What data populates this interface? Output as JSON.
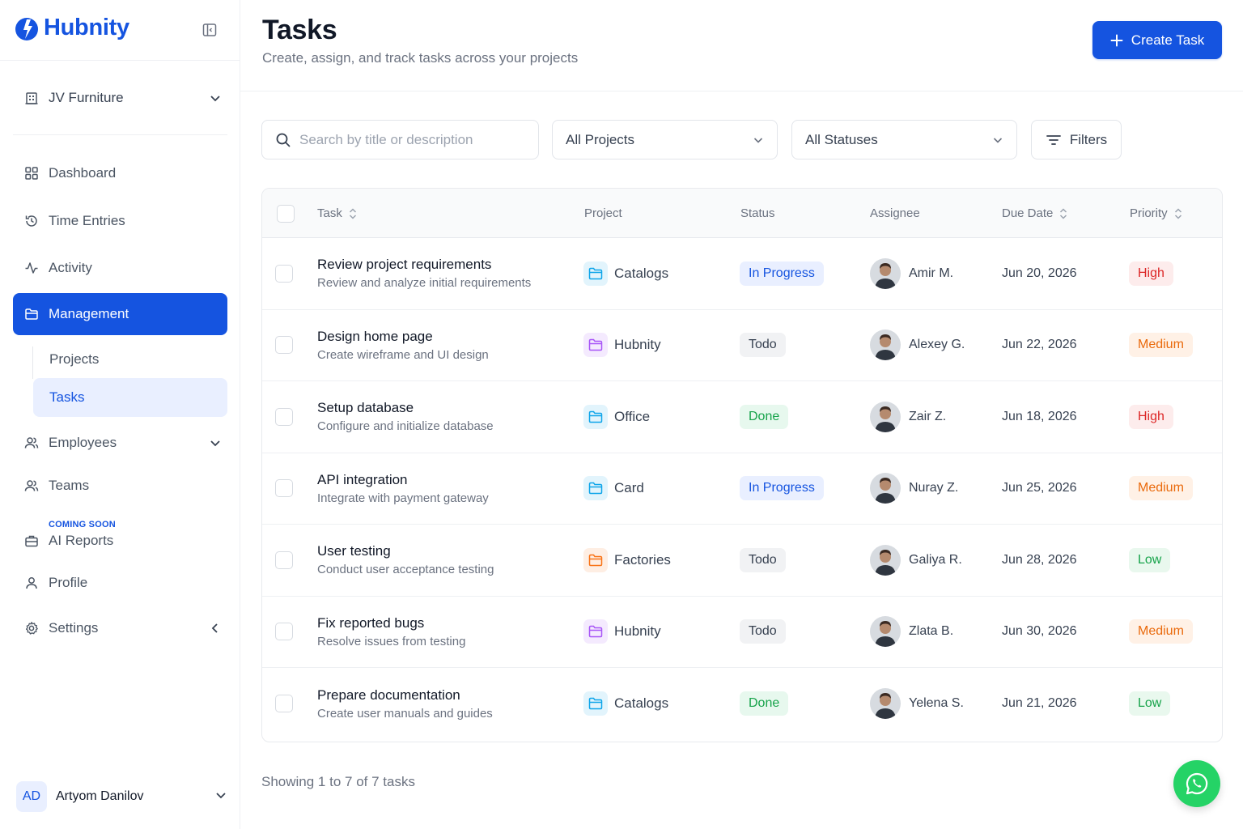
{
  "brand": {
    "name": "Hubnity",
    "accent": "#1554e0"
  },
  "sidebar": {
    "org": {
      "label": "JV Furniture",
      "icon": "building-icon"
    },
    "nav": [
      {
        "label": "Dashboard",
        "icon": "grid-icon"
      },
      {
        "label": "Time Entries",
        "icon": "history-icon"
      },
      {
        "label": "Activity",
        "icon": "activity-icon"
      },
      {
        "label": "Management",
        "icon": "folder-icon"
      },
      {
        "label": "Employees",
        "icon": "users-icon"
      },
      {
        "label": "Teams",
        "icon": "users-icon"
      },
      {
        "label": "AI Reports",
        "icon": "briefcase-icon",
        "tag": "COMING SOON"
      },
      {
        "label": "Profile",
        "icon": "user-icon"
      },
      {
        "label": "Settings",
        "icon": "gear-icon"
      }
    ],
    "sub_nav": [
      {
        "label": "Projects"
      },
      {
        "label": "Tasks"
      }
    ],
    "user": {
      "initials": "AD",
      "name": "Artyom Danilov"
    }
  },
  "header": {
    "title": "Tasks",
    "subtitle": "Create, assign, and track tasks across your projects",
    "create_label": "Create Task"
  },
  "toolbar": {
    "search_placeholder": "Search by title or description",
    "project_filter": "All Projects",
    "status_filter": "All Statuses",
    "filters_label": "Filters"
  },
  "table": {
    "columns": [
      "Task",
      "Project",
      "Status",
      "Assignee",
      "Due Date",
      "Priority"
    ],
    "rows": [
      {
        "title": "Review project requirements",
        "desc": "Review and analyze initial requirements",
        "project": "Catalogs",
        "project_color": "#0ea5e9",
        "status": "In Progress",
        "assignee": "Amir M.",
        "due": "Jun 20, 2026",
        "priority": "High"
      },
      {
        "title": "Design home page",
        "desc": "Create wireframe and UI design",
        "project": "Hubnity",
        "project_color": "#a855f7",
        "status": "Todo",
        "assignee": "Alexey G.",
        "due": "Jun 22, 2026",
        "priority": "Medium"
      },
      {
        "title": "Setup database",
        "desc": "Configure and initialize database",
        "project": "Office",
        "project_color": "#0ea5e9",
        "status": "Done",
        "assignee": "Zair Z.",
        "due": "Jun 18, 2026",
        "priority": "High"
      },
      {
        "title": "API integration",
        "desc": "Integrate with payment gateway",
        "project": "Card",
        "project_color": "#0ea5e9",
        "status": "In Progress",
        "assignee": "Nuray Z.",
        "due": "Jun 25, 2026",
        "priority": "Medium"
      },
      {
        "title": "User testing",
        "desc": "Conduct user acceptance testing",
        "project": "Factories",
        "project_color": "#f97316",
        "status": "Todo",
        "assignee": "Galiya R.",
        "due": "Jun 28, 2026",
        "priority": "Low"
      },
      {
        "title": "Fix reported bugs",
        "desc": "Resolve issues from testing",
        "project": "Hubnity",
        "project_color": "#a855f7",
        "status": "Todo",
        "assignee": "Zlata B.",
        "due": "Jun 30, 2026",
        "priority": "Medium"
      },
      {
        "title": "Prepare documentation",
        "desc": "Create user manuals and guides",
        "project": "Catalogs",
        "project_color": "#0ea5e9",
        "status": "Done",
        "assignee": "Yelena S.",
        "due": "Jun 21, 2026",
        "priority": "Low"
      }
    ]
  },
  "footer": {
    "showing": "Showing 1 to 7 of 7 tasks"
  }
}
